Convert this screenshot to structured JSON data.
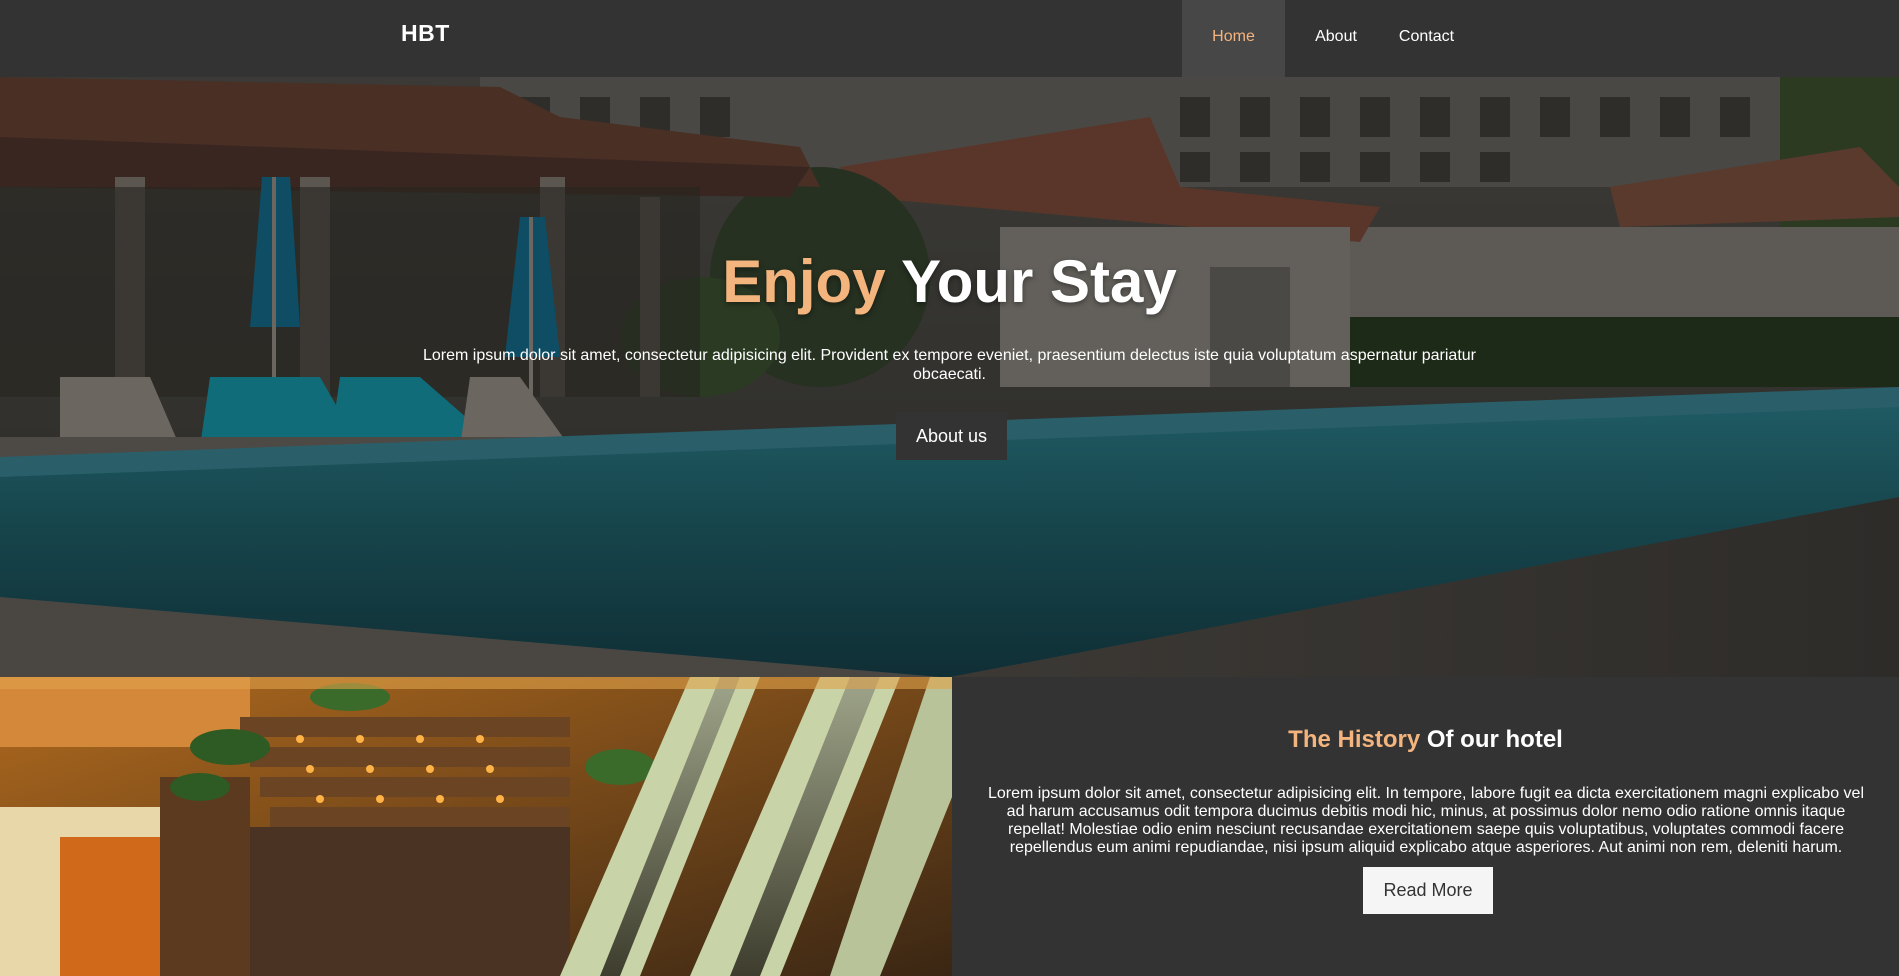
{
  "navbar": {
    "brand": "HBT",
    "items": [
      {
        "label": "Home",
        "active": true
      },
      {
        "label": "About",
        "active": false
      },
      {
        "label": "Contact",
        "active": false
      }
    ]
  },
  "hero": {
    "title_accent": "Enjoy",
    "title_rest": " Your Stay",
    "text": "Lorem ipsum dolor sit amet, consectetur adipisicing elit. Provident ex tempore eveniet, praesentium delectus iste quia voluptatum aspernatur pariatur obcaecati.",
    "button": "About us"
  },
  "history": {
    "title_accent": "The History",
    "title_rest": " Of our hotel",
    "text": "Lorem ipsum dolor sit amet, consectetur adipisicing elit. In tempore, labore fugit ea dicta exercitationem magni explicabo vel ad harum accusamus odit tempora ducimus debitis modi hic, minus, at possimus dolor nemo odio ratione omnis itaque repellat! Molestiae odio enim nesciunt recusandae exercitationem saepe quis voluptatibus, voluptates commodi facere repellendus eum animi repudiandae, nisi ipsum aliquid explicabo atque asperiores. Aut animi non rem, deleniti harum.",
    "button": "Read More"
  },
  "colors": {
    "background": "#333333",
    "accent": "#f4b47e",
    "nav_active_bg": "#474747",
    "button_light": "#f5f5f5"
  }
}
